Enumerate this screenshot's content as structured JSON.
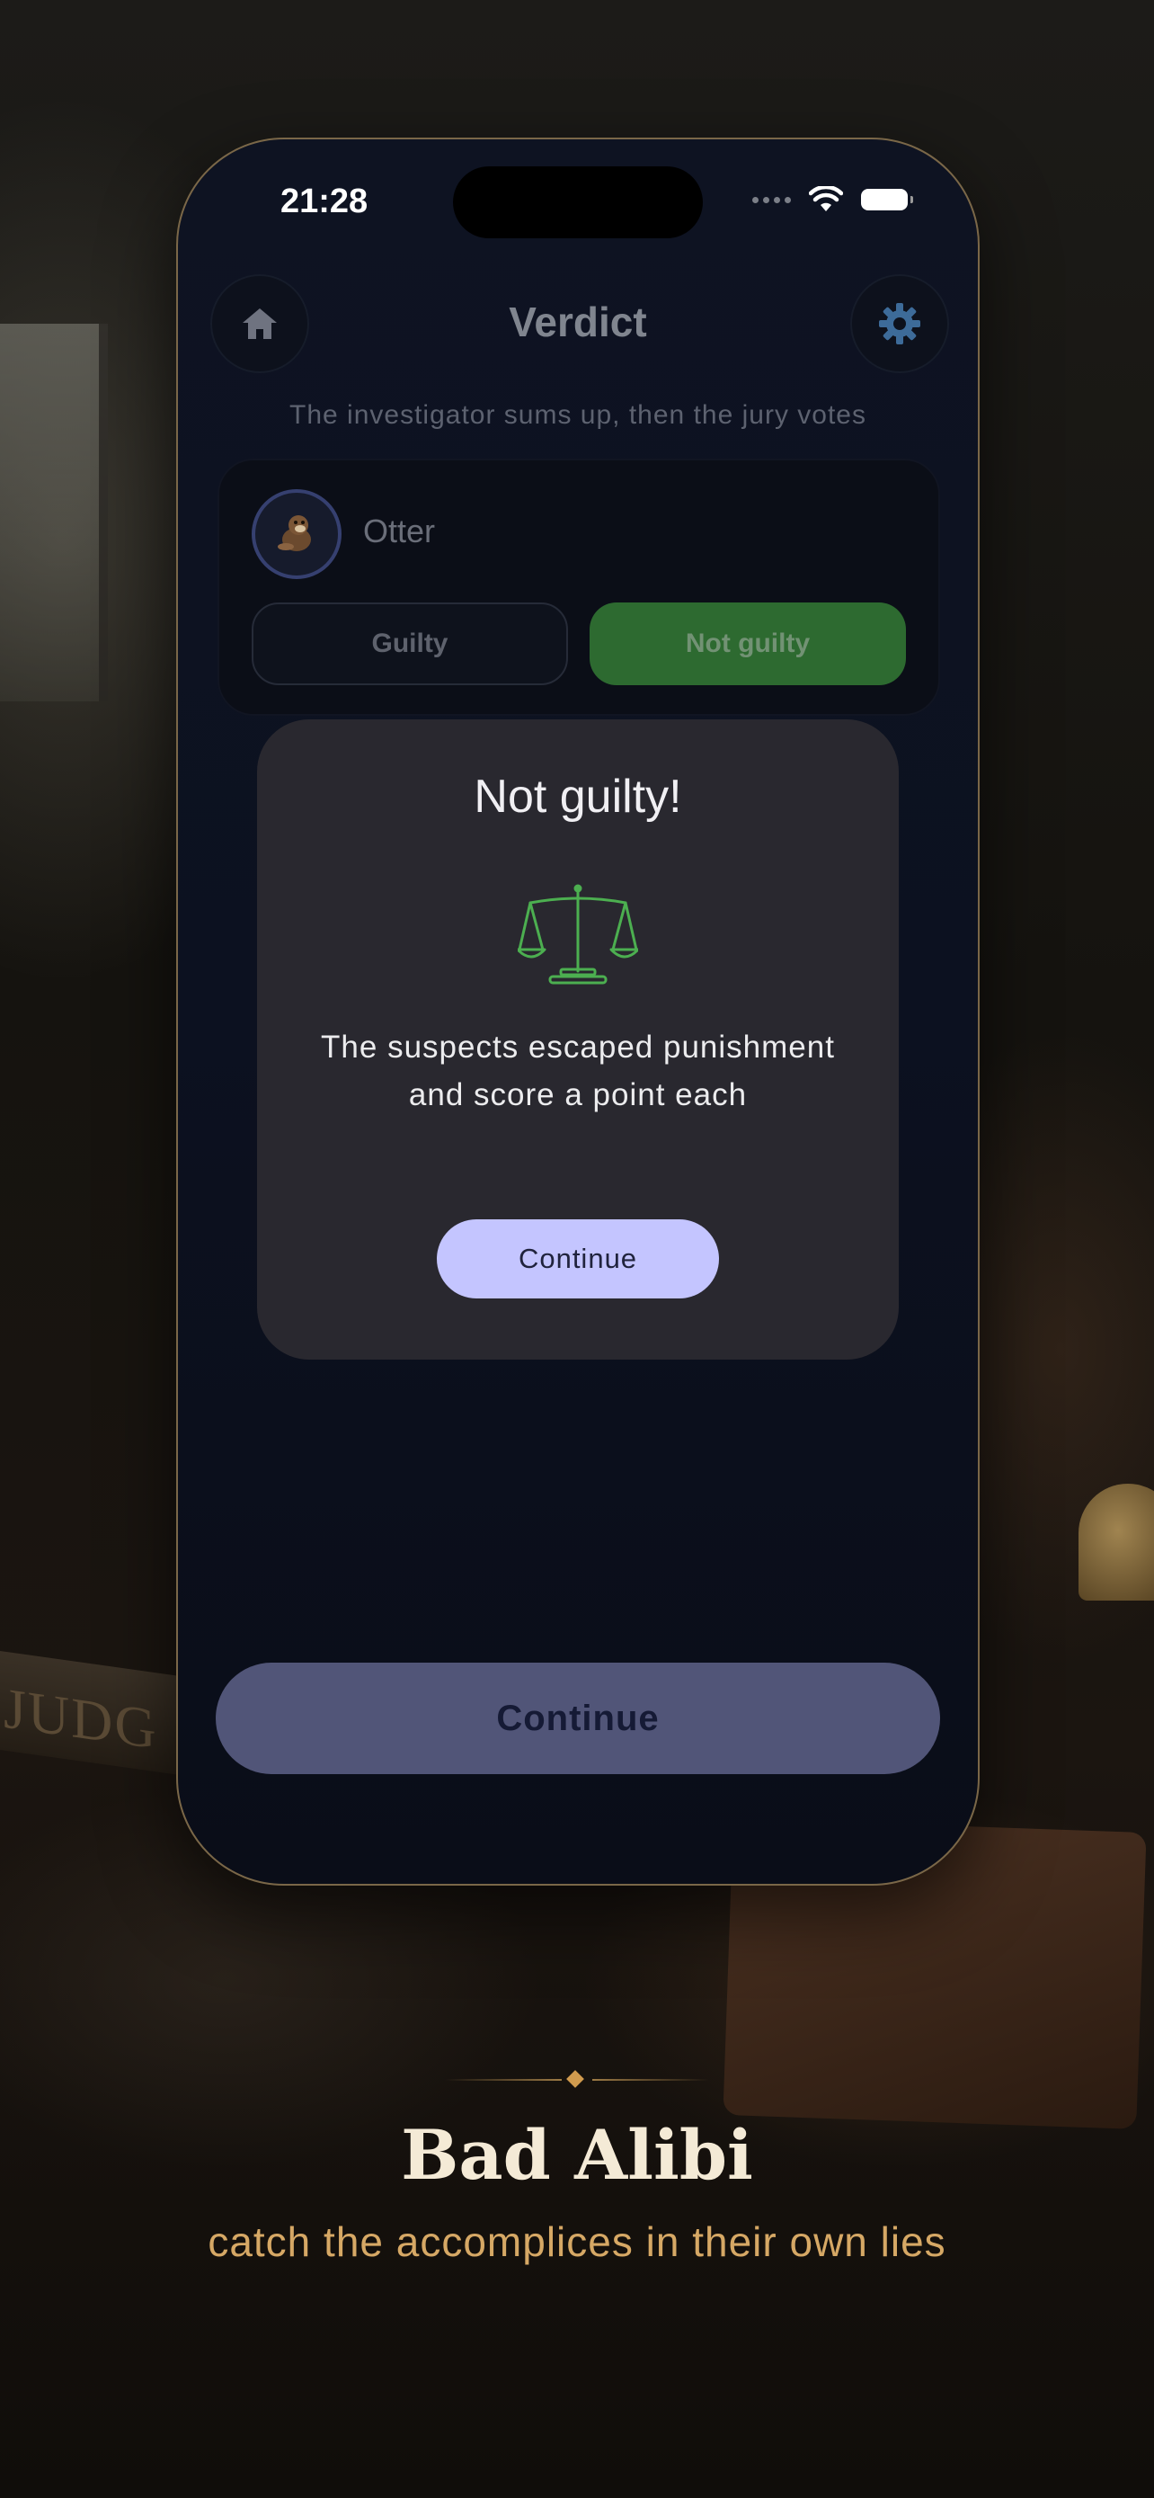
{
  "status_bar": {
    "time": "21:28"
  },
  "screen": {
    "title": "Verdict",
    "subtitle": "The investigator sums up, then the jury votes",
    "player": {
      "name": "Otter"
    },
    "votes": {
      "guilty": "Guilty",
      "not_guilty": "Not guilty"
    },
    "continue": "Continue"
  },
  "modal": {
    "title": "Not guilty!",
    "message": "The suspects escaped punishment and score a point each",
    "button": "Continue",
    "icon": "scales-icon"
  },
  "promo": {
    "brand": "Bad Alibi",
    "tagline": "catch the accomplices in their own lies"
  },
  "background_text": {
    "plaque": "JUDG"
  },
  "colors": {
    "accent_green": "#2d6a30",
    "modal_button": "#c4c5ff",
    "main_button": "#515578",
    "tagline": "#d6a865"
  }
}
